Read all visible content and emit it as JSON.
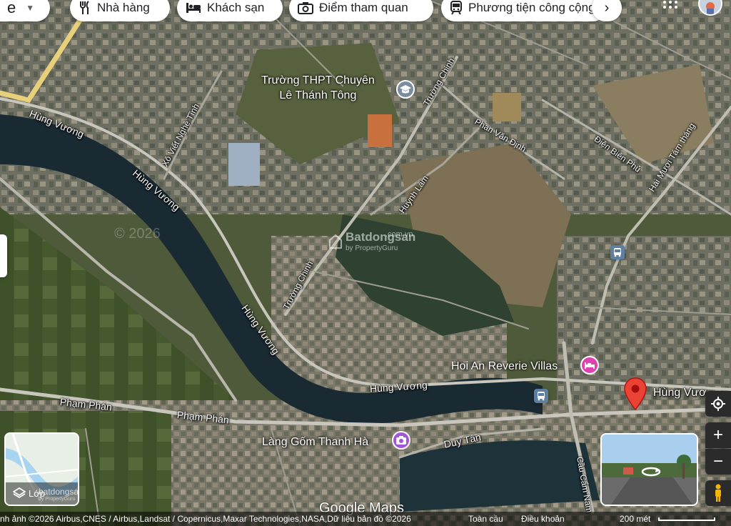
{
  "search": {
    "value": "e"
  },
  "chips": [
    {
      "label": "Nhà hàng",
      "icon": "restaurant-icon"
    },
    {
      "label": "Khách sạn",
      "icon": "hotel-icon"
    },
    {
      "label": "Điểm tham quan",
      "icon": "camera-icon"
    },
    {
      "label": "Phương tiện công cộng",
      "icon": "transit-icon"
    }
  ],
  "streets": [
    {
      "text": "Hùng Vương"
    },
    {
      "text": "Hùng Vương"
    },
    {
      "text": "Hùng Vương"
    },
    {
      "text": "Hùng Vương"
    },
    {
      "text": "Hùng Vươ"
    },
    {
      "text": "Xô Viết Nghệ Tĩnh"
    },
    {
      "text": "Trường Chinh"
    },
    {
      "text": "Trường Chinh"
    },
    {
      "text": "Phan Văn Định"
    },
    {
      "text": "Điện Biên Phủ"
    },
    {
      "text": "Hai Mươi Tám tháng"
    },
    {
      "text": "Huỳnh Lâm"
    },
    {
      "text": "Phạm Phán"
    },
    {
      "text": "Phạm Phán"
    },
    {
      "text": "Duy Tân"
    },
    {
      "text": "Cầu Cẩm Nam"
    }
  ],
  "pois": {
    "school": {
      "line1": "Trường THPT Chuyên",
      "line2": "Lê Thánh Tông",
      "icon": "school-icon",
      "color": "#7b8c9c"
    },
    "villa": {
      "label": "Hoi An Reverie Villas",
      "icon": "bed-icon",
      "color": "#e040b0"
    },
    "pottery": {
      "label": "Làng Gốm Thanh Hà",
      "icon": "camera-icon",
      "color": "#a157d6"
    }
  },
  "watermark": {
    "brand": "Batdongsan",
    "sub": "by PropertyGuru",
    "domain": ".com.vn",
    "copy": "© 2026"
  },
  "layers": {
    "label": "Lớp",
    "overlay": "batdongsan",
    "sub": "by PropertyGuru"
  },
  "google_logo": "Google Maps",
  "footer": {
    "attribution": "nh ảnh ©2026 Airbus,CNES / Airbus,Landsat / Copernicus,Maxar Technologies,NASA,Dữ liệu bản đồ ©2026",
    "global": "Toàn cầu",
    "terms": "Điều khoản",
    "scale": "200 mét"
  },
  "colors": {
    "pin": "#ea4335",
    "accent": "#1a73e8"
  }
}
